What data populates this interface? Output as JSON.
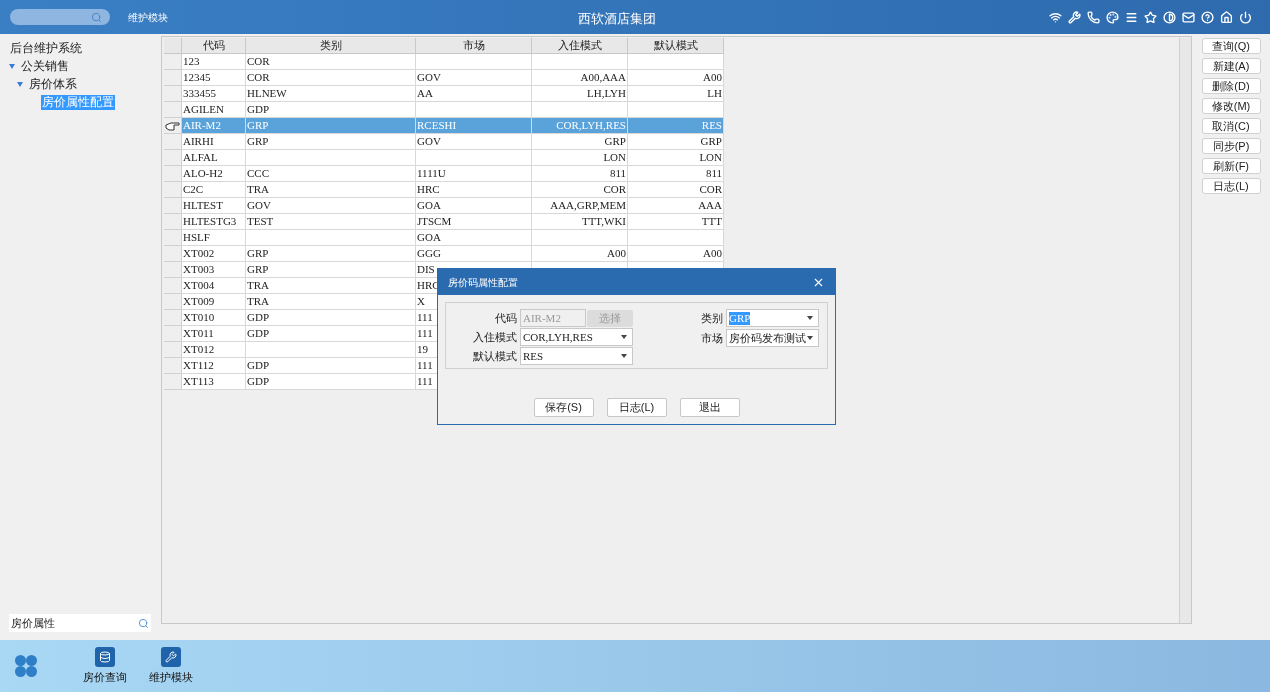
{
  "header": {
    "module_label": "维护模块",
    "title": "西软酒店集团"
  },
  "sidebar": {
    "tree": [
      {
        "label": "后台维护系统",
        "expanded": false,
        "selected": false
      },
      {
        "label": "公关销售",
        "expanded": true,
        "selected": false,
        "children": [
          {
            "label": "房价体系",
            "expanded": true,
            "selected": false,
            "children": [
              {
                "label": "房价属性配置",
                "expanded": false,
                "selected": true
              }
            ]
          }
        ]
      }
    ],
    "search": {
      "value": "房价属性"
    }
  },
  "table": {
    "columns": [
      {
        "label": "代码"
      },
      {
        "label": "类别"
      },
      {
        "label": "市场"
      },
      {
        "label": "入住模式"
      },
      {
        "label": "默认模式"
      }
    ],
    "rows": [
      {
        "selected": false,
        "cells": [
          "123",
          "COR",
          "",
          "",
          ""
        ]
      },
      {
        "selected": false,
        "cells": [
          "12345",
          "COR",
          "GOV",
          "A00,AAA",
          "A00"
        ]
      },
      {
        "selected": false,
        "cells": [
          "333455",
          "HLNEW",
          "AA",
          "LH,LYH",
          "LH"
        ]
      },
      {
        "selected": false,
        "cells": [
          "AGILEN",
          "GDP",
          "",
          "",
          ""
        ]
      },
      {
        "selected": true,
        "cells": [
          "AIR-M2",
          "GRP",
          "RCESHI",
          "COR,LYH,RES",
          "RES"
        ]
      },
      {
        "selected": false,
        "cells": [
          "AIRHI",
          "GRP",
          "GOV",
          "GRP",
          "GRP"
        ]
      },
      {
        "selected": false,
        "cells": [
          "ALFAL",
          "",
          "",
          "LON",
          "LON"
        ]
      },
      {
        "selected": false,
        "cells": [
          "ALO-H2",
          "CCC",
          "1111U",
          "811",
          "811"
        ]
      },
      {
        "selected": false,
        "cells": [
          "C2C",
          "TRA",
          "HRC",
          "COR",
          "COR"
        ]
      },
      {
        "selected": false,
        "cells": [
          "HLTEST",
          "GOV",
          "GOA",
          "AAA,GRP,MEM",
          "AAA"
        ]
      },
      {
        "selected": false,
        "cells": [
          "HLTESTG3",
          "TEST",
          "JTSCM",
          "TTT,WKI",
          "TTT"
        ]
      },
      {
        "selected": false,
        "cells": [
          "HSLF",
          "",
          "GOA",
          "",
          ""
        ]
      },
      {
        "selected": false,
        "cells": [
          "XT002",
          "GRP",
          "GGG",
          "A00",
          "A00"
        ]
      },
      {
        "selected": false,
        "cells": [
          "XT003",
          "GRP",
          "DIS",
          "",
          ""
        ]
      },
      {
        "selected": false,
        "cells": [
          "XT004",
          "TRA",
          "HRC",
          "",
          ""
        ]
      },
      {
        "selected": false,
        "cells": [
          "XT009",
          "TRA",
          "X",
          "",
          ""
        ]
      },
      {
        "selected": false,
        "cells": [
          "XT010",
          "GDP",
          "111",
          "",
          ""
        ]
      },
      {
        "selected": false,
        "cells": [
          "XT011",
          "GDP",
          "111",
          "",
          ""
        ]
      },
      {
        "selected": false,
        "cells": [
          "XT012",
          "",
          "19",
          "",
          ""
        ]
      },
      {
        "selected": false,
        "cells": [
          "XT112",
          "GDP",
          "111",
          "",
          ""
        ]
      },
      {
        "selected": false,
        "cells": [
          "XT113",
          "GDP",
          "111",
          "",
          ""
        ]
      }
    ]
  },
  "actions": [
    "查询(Q)",
    "新建(A)",
    "删除(D)",
    "修改(M)",
    "取消(C)",
    "同步(P)",
    "刷新(F)",
    "日志(L)"
  ],
  "dialog": {
    "title": "房价码属性配置",
    "left_fields": [
      {
        "label": "代码",
        "value": "AIR-M2",
        "kind": "readonly",
        "text_selected": false,
        "button": "选择"
      },
      {
        "label": "入住模式",
        "value": "COR,LYH,RES",
        "kind": "select",
        "text_selected": false
      },
      {
        "label": "默认模式",
        "value": "RES",
        "kind": "select",
        "text_selected": false
      }
    ],
    "right_fields": [
      {
        "label": "类别",
        "value": "GRP",
        "kind": "select",
        "text_selected": true
      },
      {
        "label": "市场",
        "value": "房价码发布测试",
        "kind": "select",
        "text_selected": false
      }
    ],
    "buttons": [
      "保存(S)",
      "日志(L)",
      "退出"
    ]
  },
  "taskbar": {
    "apps": [
      {
        "label": "房价查询",
        "kind": "database"
      },
      {
        "label": "维护模块",
        "kind": "wrench"
      }
    ]
  }
}
